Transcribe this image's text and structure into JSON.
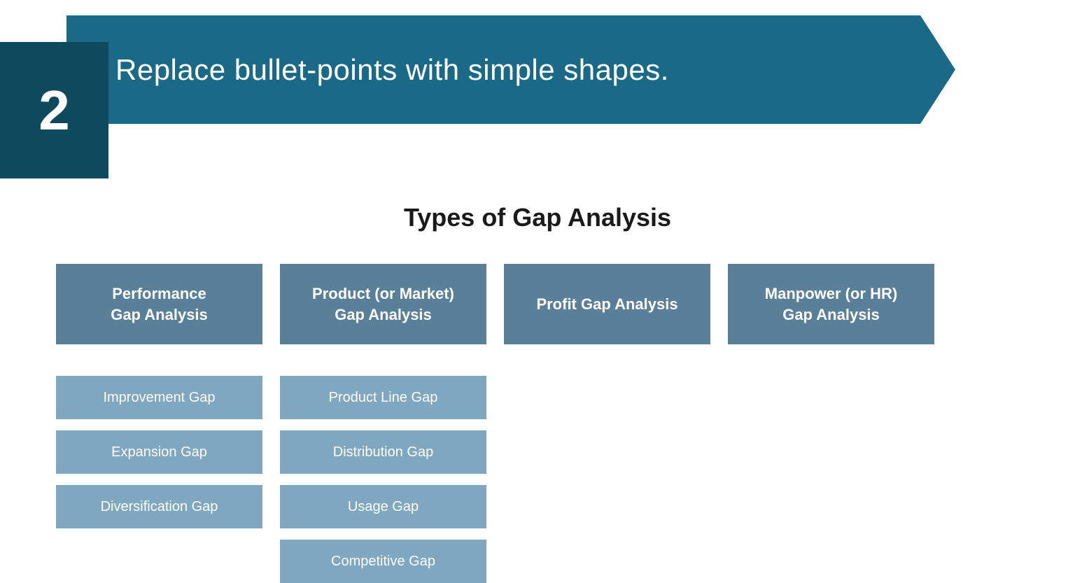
{
  "header": {
    "number": "2",
    "banner_text": "Replace bullet-points with simple shapes."
  },
  "main": {
    "section_title": "Types of Gap Analysis",
    "categories": [
      {
        "id": "performance",
        "label": "Performance\nGap Analysis"
      },
      {
        "id": "product",
        "label": "Product (or Market)\nGap Analysis"
      },
      {
        "id": "profit",
        "label": "Profit Gap Analysis"
      },
      {
        "id": "manpower",
        "label": "Manpower (or HR)\nGap Analysis"
      }
    ],
    "sub_columns": [
      {
        "for": "performance",
        "items": [
          "Improvement Gap",
          "Expansion Gap",
          "Diversification Gap"
        ]
      },
      {
        "for": "product",
        "items": [
          "Product Line Gap",
          "Distribution Gap",
          "Usage Gap",
          "Competitive Gap"
        ]
      },
      {
        "for": "profit",
        "items": []
      },
      {
        "for": "manpower",
        "items": []
      }
    ]
  }
}
